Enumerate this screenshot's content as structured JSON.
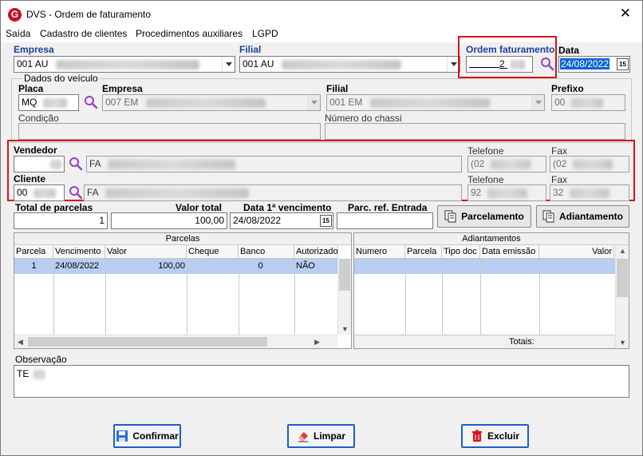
{
  "window": {
    "title": "DVS - Ordem de faturamento",
    "close_glyph": "✕",
    "icon_letter": "G"
  },
  "menu": [
    "Saída",
    "Cadastro de clientes",
    "Procedimentos auxiliares",
    "LGPD"
  ],
  "empresa": {
    "label": "Empresa",
    "value": "001 AU"
  },
  "filial": {
    "label": "Filial",
    "value": "001 AU"
  },
  "ordem": {
    "label": "Ordem faturamento",
    "value": "2"
  },
  "data": {
    "label": "Data",
    "value": "24/08/2022",
    "cal_glyph": "15"
  },
  "veiculo": {
    "group_label": "Dados do veículo",
    "placa_label": "Placa",
    "placa_value": "MQ",
    "empresa_label": "Empresa",
    "empresa_value": "007 EM",
    "filial_label": "Filial",
    "filial_value": "001 EM",
    "prefixo_label": "Prefixo",
    "prefixo_value": "00",
    "condicao_label": "Condição",
    "chassi_label": "Número do chassi"
  },
  "vendedor": {
    "label": "Vendedor",
    "name": "FA",
    "tel_label": "Telefone",
    "tel_value": "(02",
    "fax_label": "Fax",
    "fax_value": "(02"
  },
  "cliente": {
    "label": "Cliente",
    "code": "00",
    "name": "FA",
    "tel_label": "Telefone",
    "tel_value": "92",
    "fax_label": "Fax",
    "fax_value": "32"
  },
  "totals": {
    "parcelas_label": "Total de parcelas",
    "parcelas_value": "1",
    "valor_label": "Valor total",
    "valor_value": "100,00",
    "venc_label": "Data 1ª vencimento",
    "venc_value": "24/08/2022",
    "parc_ref_label": "Parc. ref. Entrada"
  },
  "buttons": {
    "parcelamento": "Parcelamento",
    "adiantamento": "Adiantamento",
    "confirmar": "Confirmar",
    "limpar": "Limpar",
    "excluir": "Excluir"
  },
  "parcelas_grid": {
    "caption": "Parcelas",
    "columns": [
      "Parcela",
      "Vencimento",
      "Valor",
      "Cheque",
      "Banco",
      "Autorizado"
    ],
    "row": [
      "1",
      "24/08/2022",
      "100,00",
      "",
      "0",
      "NÃO"
    ]
  },
  "adiantamentos_grid": {
    "caption": "Adiantamentos",
    "columns": [
      "Numero",
      "Parcela",
      "Tipo doc",
      "Data emissão",
      "Valor"
    ],
    "totais_label": "Totais:"
  },
  "observacao": {
    "label": "Observação",
    "value": "TE"
  }
}
